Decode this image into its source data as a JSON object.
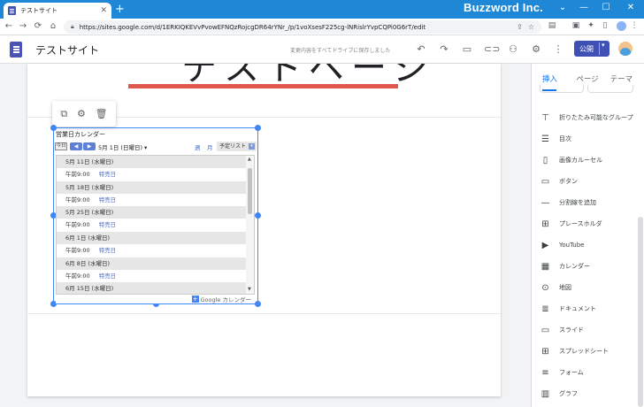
{
  "browser": {
    "tab_title": "テストサイト",
    "tab_close": "✕",
    "new_tab": "+",
    "brand": "Buzzword Inc.",
    "url": "https://sites.google.com/d/1ERKIQKEVvPvowEFNQzRojcgDR64rYNr_/p/1voXsesF225cg-lNRislrYvpCQPi0G6rT/edit",
    "nav": {
      "back": "←",
      "forward": "→",
      "reload": "⟳",
      "home": "⌂"
    },
    "window_controls": {
      "collapse": "⌄",
      "minimize": "—",
      "maximize": "☐",
      "close": "✕"
    }
  },
  "sites": {
    "site_name": "テストサイト",
    "save_status": "変更内容をすべてドライブに保存しました",
    "publish_label": "公開",
    "publish_dropdown": "▾"
  },
  "page": {
    "heading": "テストページ"
  },
  "calendar": {
    "title": "営業日カレンダー",
    "today_label": "今日",
    "prev": "◀",
    "next": "▶",
    "current_date": "5月 1日 (日曜日) ▾",
    "view_week": "週",
    "view_month": "月",
    "view_list": "予定リスト",
    "view_list_arrow": "▾",
    "footer_plus": "+",
    "footer_text": "Google カレンダー",
    "entries": [
      {
        "day": "5月 11日 (水曜日)",
        "time": "午前9:00",
        "event": "特売日"
      },
      {
        "day": "5月 18日 (水曜日)",
        "time": "午前9:00",
        "event": "特売日"
      },
      {
        "day": "5月 25日 (水曜日)",
        "time": "午前9:00",
        "event": "特売日"
      },
      {
        "day": "6月 1日 (水曜日)",
        "time": "午前9:00",
        "event": "特売日"
      },
      {
        "day": "6月 8日 (水曜日)",
        "time": "午前9:00",
        "event": "特売日"
      },
      {
        "day": "6月 15日 (水曜日)",
        "time": "",
        "event": ""
      }
    ]
  },
  "panel": {
    "tabs": [
      "挿入",
      "ページ",
      "テーマ"
    ],
    "items": [
      {
        "icon": "collapsible-group-icon",
        "glyph": "⊤",
        "label": "折りたたみ可能なグループ"
      },
      {
        "icon": "table-of-contents-icon",
        "glyph": "☰",
        "label": "目次"
      },
      {
        "icon": "carousel-icon",
        "glyph": "▯",
        "label": "画像カルーセル"
      },
      {
        "icon": "button-icon",
        "glyph": "▭",
        "label": "ボタン"
      },
      {
        "icon": "divider-icon",
        "glyph": "—",
        "label": "分割線を追加"
      },
      {
        "icon": "placeholder-icon",
        "glyph": "⊞",
        "label": "プレースホルダ"
      },
      {
        "icon": "youtube-icon",
        "glyph": "▶",
        "label": "YouTube"
      },
      {
        "icon": "calendar-icon",
        "glyph": "▦",
        "label": "カレンダー"
      },
      {
        "icon": "map-pin-icon",
        "glyph": "⊙",
        "label": "地図"
      },
      {
        "icon": "docs-icon",
        "glyph": "≣",
        "label": "ドキュメント"
      },
      {
        "icon": "slides-icon",
        "glyph": "▭",
        "label": "スライド"
      },
      {
        "icon": "sheets-icon",
        "glyph": "⊞",
        "label": "スプレッドシート"
      },
      {
        "icon": "forms-icon",
        "glyph": "≡",
        "label": "フォーム"
      },
      {
        "icon": "chart-icon",
        "glyph": "▥",
        "label": "グラフ"
      }
    ]
  },
  "colors": {
    "accent": "#1a73e8",
    "publish": "#3f51b5",
    "chrome": "#1e88d6",
    "heading_bar": "#e2574c"
  }
}
